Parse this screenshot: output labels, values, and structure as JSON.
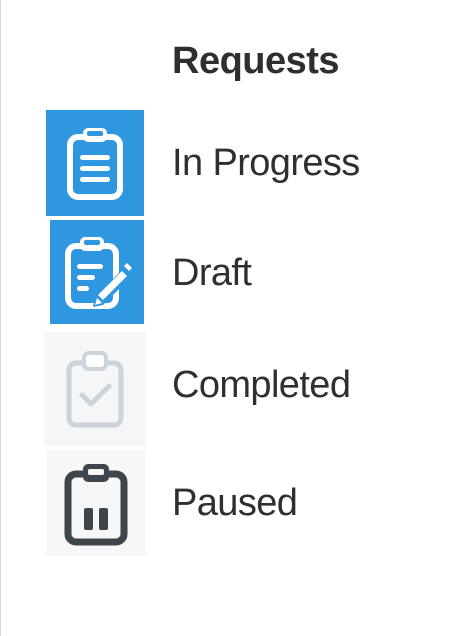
{
  "panel": {
    "title": "Requests",
    "accent_color": "#2f96e0",
    "items": [
      {
        "label": "In Progress",
        "icon": "clipboard-list-icon",
        "tile_color": "#2f96e0"
      },
      {
        "label": "Draft",
        "icon": "clipboard-edit-icon",
        "tile_color": "#2f96e0"
      },
      {
        "label": "Completed",
        "icon": "clipboard-check-icon",
        "tile_color": "#f4f6f8"
      },
      {
        "label": "Paused",
        "icon": "clipboard-pause-icon",
        "tile_color": "#f6f7f8"
      }
    ]
  }
}
